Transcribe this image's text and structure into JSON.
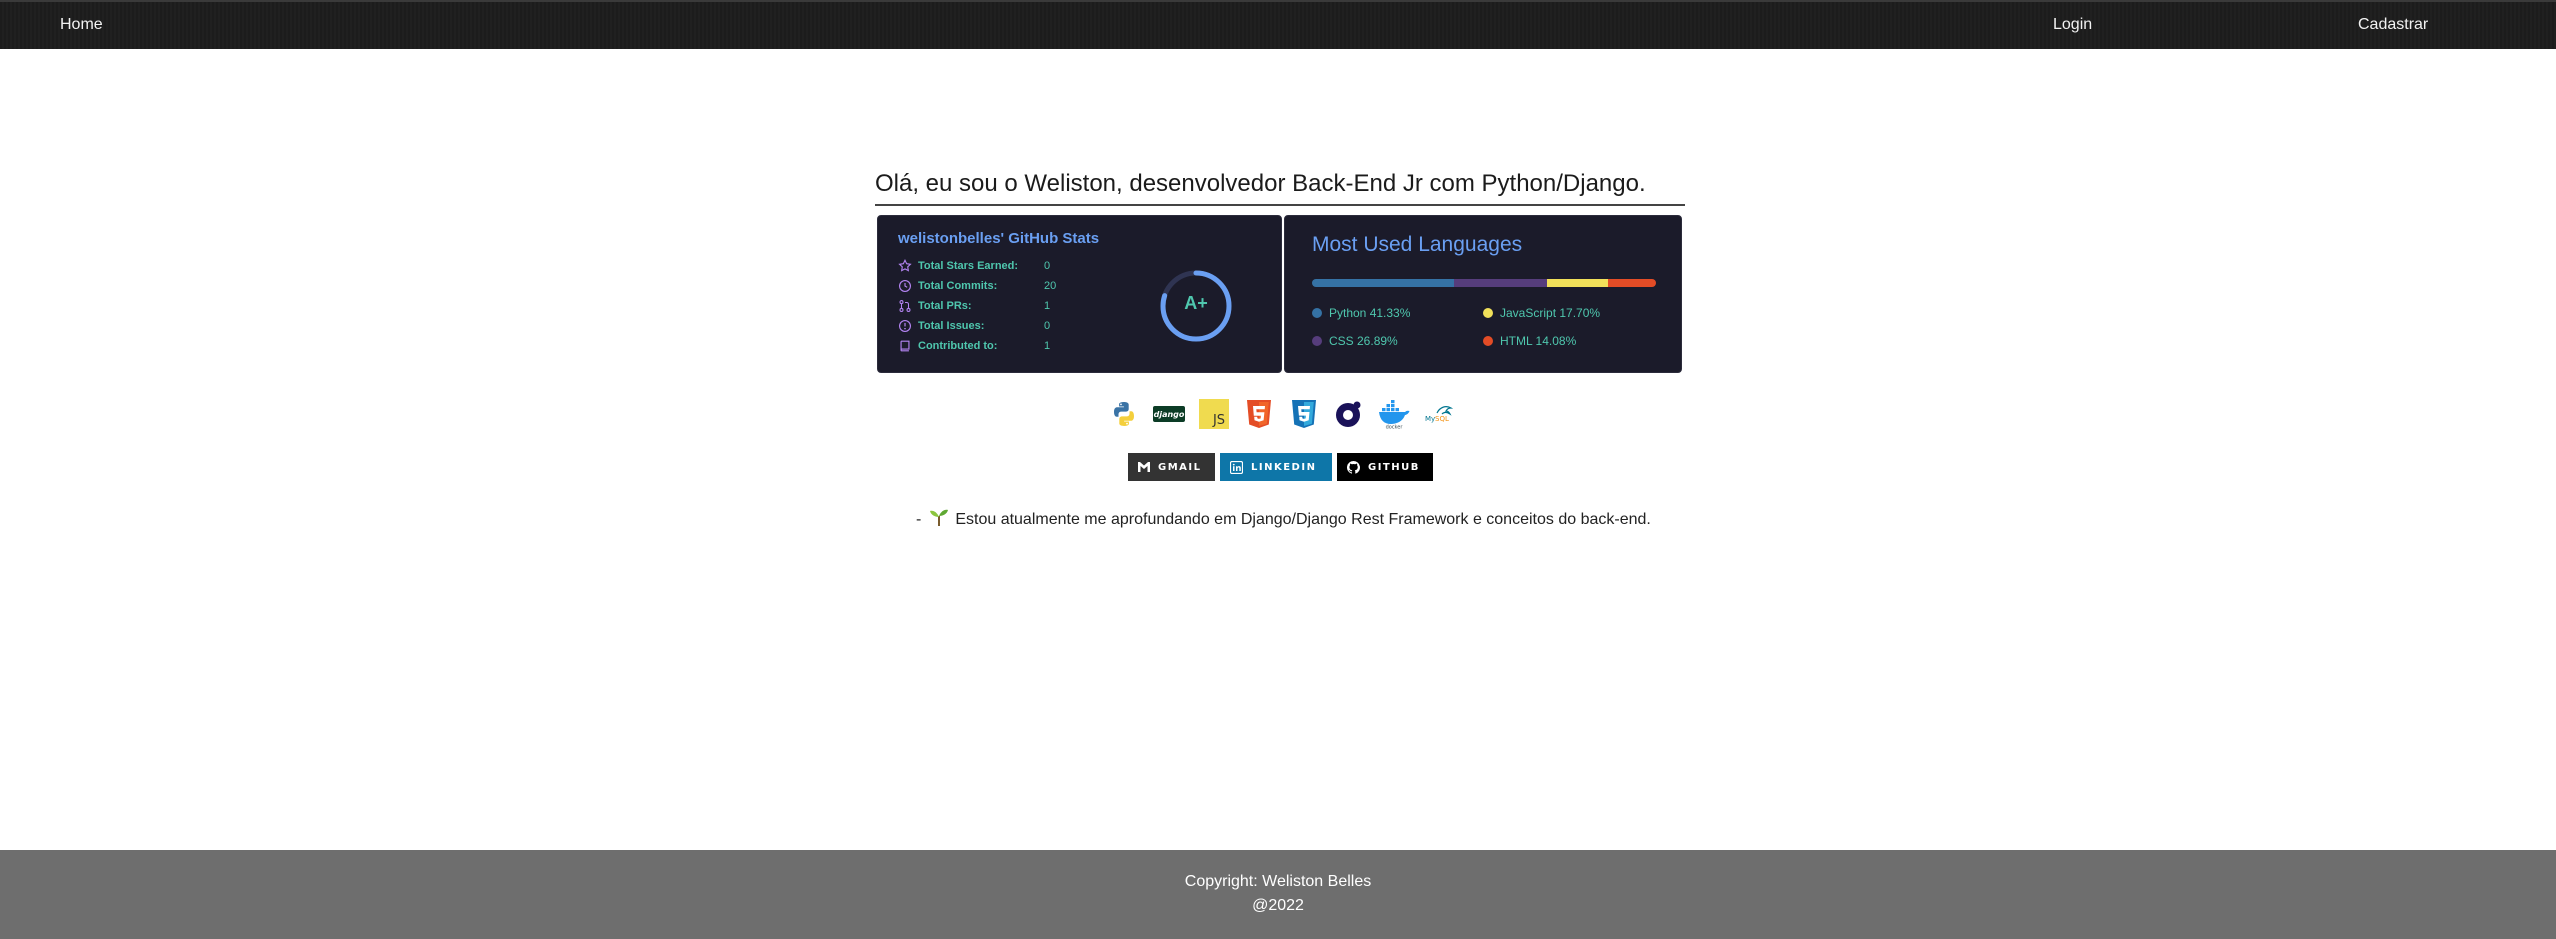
{
  "nav": {
    "home": "Home",
    "login": "Login",
    "signup": "Cadastrar"
  },
  "heading": "Olá, eu sou o Weliston, desenvolvedor Back-End Jr com Python/Django.",
  "stats": {
    "title": "welistonbelles' GitHub Stats",
    "rows": [
      {
        "label": "Total Stars Earned:",
        "value": "0",
        "icon": "star-icon"
      },
      {
        "label": "Total Commits:",
        "value": "20",
        "icon": "clock-icon"
      },
      {
        "label": "Total PRs:",
        "value": "1",
        "icon": "pull-request-icon"
      },
      {
        "label": "Total Issues:",
        "value": "0",
        "icon": "issue-icon"
      },
      {
        "label": "Contributed to:",
        "value": "1",
        "icon": "repo-icon"
      }
    ],
    "rank": "A+",
    "rank_progress": 0.8
  },
  "languages": {
    "title": "Most Used Languages",
    "items": [
      {
        "label": "Python 41.33%",
        "percent": 41.33,
        "color": "#3572A5"
      },
      {
        "label": "CSS 26.89%",
        "percent": 26.89,
        "color": "#563d7c"
      },
      {
        "label": "JavaScript 17.70%",
        "percent": 17.7,
        "color": "#f1e05a"
      },
      {
        "label": "HTML 14.08%",
        "percent": 14.08,
        "color": "#e34c26"
      }
    ]
  },
  "tech_icons": [
    "python-icon",
    "django-icon",
    "javascript-icon",
    "html5-icon",
    "css3-icon",
    "heroku-icon",
    "docker-icon",
    "mysql-icon"
  ],
  "badges": {
    "gmail": "GMAIL",
    "linkedin": "LINKEDIN",
    "github": "GITHUB"
  },
  "status": {
    "prefix": "-",
    "text": "Estou atualmente me aprofundando em Django/Django Rest Framework e conceitos do back-end."
  },
  "footer": {
    "copyright": "Copyright: Weliston Belles",
    "year": "@2022"
  },
  "colors": {
    "card_bg": "#1b1b2a",
    "title_blue": "#6a9ff2",
    "stat_teal": "#4fc7ae",
    "icon_purple": "#b384f2"
  }
}
